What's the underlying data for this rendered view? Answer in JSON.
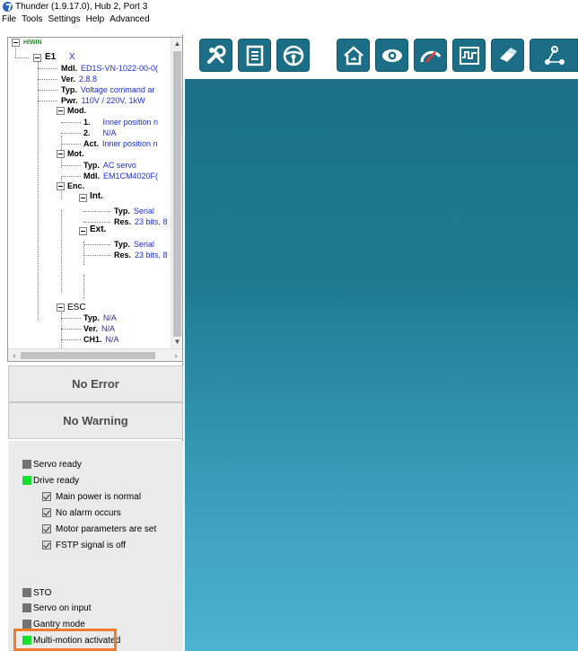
{
  "window": {
    "title": "Thunder (1.9.17.0), Hub 2, Port 3"
  },
  "menu": [
    "File",
    "Tools",
    "Settings",
    "Help",
    "Advanced"
  ],
  "tree": {
    "root": "HIWIN",
    "e1_label": "E1",
    "e1_value": "X",
    "drive": [
      {
        "k": "Mdl.",
        "v": "ED1S-VN-1022-00-0("
      },
      {
        "k": "Ver.",
        "v": "2.8.8"
      },
      {
        "k": "Typ.",
        "v": "Voltage command ar"
      },
      {
        "k": "Pwr.",
        "v": "110V / 220V, 1kW"
      }
    ],
    "mod_label": "Mod.",
    "mod": [
      {
        "k": "1.",
        "v": "Inner position n"
      },
      {
        "k": "2.",
        "v": "N/A"
      },
      {
        "k": "Act.",
        "v": "Inner position n"
      }
    ],
    "mot_label": "Mot.",
    "mot": [
      {
        "k": "Typ.",
        "v": "AC servo"
      },
      {
        "k": "Mdl.",
        "v": "EM1CM4020F("
      }
    ],
    "enc_label": "Enc.",
    "int_label": "Int.",
    "int": [
      {
        "k": "Typ.",
        "v": "Serial"
      },
      {
        "k": "Res.",
        "v": "23 bits, 8"
      }
    ],
    "ext_label": "Ext.",
    "ext": [
      {
        "k": "Typ.",
        "v": "Serial"
      },
      {
        "k": "Res.",
        "v": "23 bits, 8"
      }
    ],
    "esc_label": "ESC",
    "esc": [
      {
        "k": "Typ.",
        "v": "N/A"
      },
      {
        "k": "Ver.",
        "v": "N/A"
      },
      {
        "k": "CH1.",
        "v": "N/A"
      }
    ]
  },
  "status": {
    "error": "No Error",
    "warning": "No Warning"
  },
  "indicators": {
    "servo_ready": "Servo ready",
    "drive_ready": "Drive ready",
    "checks": [
      "Main power is normal",
      "No alarm occurs",
      "Motor parameters are set",
      "FSTP signal is off"
    ],
    "sto": "STO",
    "servo_on_input": "Servo on input",
    "gantry_mode": "Gantry mode",
    "multi_motion": "Multi-motion activated"
  },
  "colors": {
    "led_on": "#17e02c",
    "led_off": "#737373",
    "toolbar_button": "#1b6e86",
    "highlight": "#ef7c2c"
  },
  "toolbar_icons": [
    "tools-icon",
    "parameters-icon",
    "steering-wheel-icon",
    "home-icon",
    "monitor-eye-icon",
    "gauge-icon",
    "scope-icon",
    "connector-icon",
    "network-icon"
  ]
}
